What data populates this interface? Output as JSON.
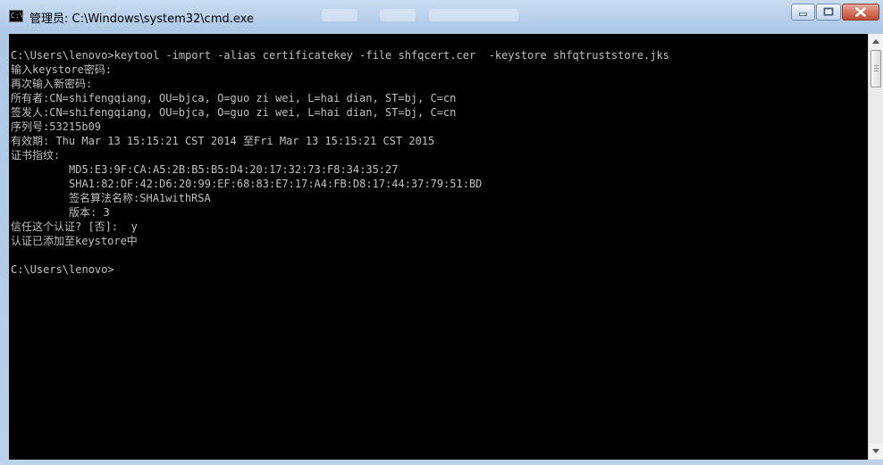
{
  "window": {
    "title": "管理员: C:\\Windows\\system32\\cmd.exe",
    "icon": "cmd-icon",
    "buttons": {
      "minimize": "minimize-icon",
      "maximize": "maximize-icon",
      "close": "close-icon"
    }
  },
  "console": {
    "lines": [
      "",
      "C:\\Users\\lenovo>keytool -import -alias certificatekey -file shfqcert.cer  -keystore shfqtruststore.jks",
      "输入keystore密码:",
      "再次输入新密码:",
      "所有者:CN=shifengqiang, OU=bjca, O=guo zi wei, L=hai dian, ST=bj, C=cn",
      "签发人:CN=shifengqiang, OU=bjca, O=guo zi wei, L=hai dian, ST=bj, C=cn",
      "序列号:53215b09",
      "有效期: Thu Mar 13 15:15:21 CST 2014 至Fri Mar 13 15:15:21 CST 2015",
      "证书指纹:",
      "         MD5:E3:9F:CA:A5:2B:B5:B5:D4:20:17:32:73:F8:34:35:27",
      "         SHA1:82:DF:42:D6:20:99:EF:68:83:E7:17:A4:FB:D8:17:44:37:79:51:BD",
      "         签名算法名称:SHA1withRSA",
      "         版本: 3",
      "信任这个认证? [否]:  y",
      "认证已添加至keystore中",
      "",
      "C:\\Users\\lenovo>"
    ]
  },
  "colors": {
    "console_bg": "#000000",
    "console_text": "#c0c0c0",
    "frame": "#aec8e6",
    "close_button": "#c14a30"
  }
}
